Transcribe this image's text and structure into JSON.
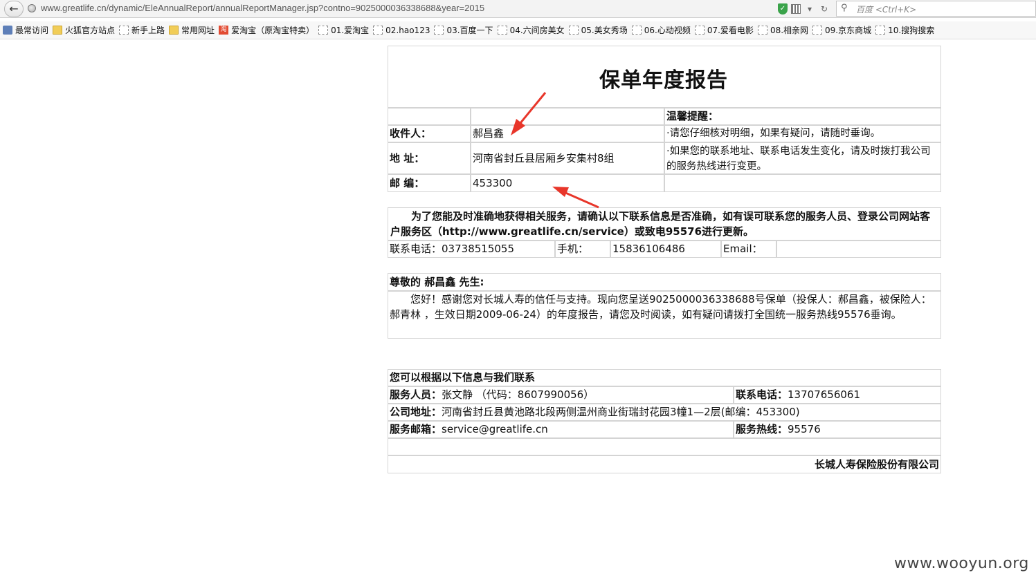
{
  "browser": {
    "url": "www.greatlife.cn/dynamic/EleAnnualReport/annualReportManager.jsp?contno=9025000036338688&year=2015",
    "search_placeholder": "百度 <Ctrl+K>",
    "bookmarks": [
      "最常访问",
      "火狐官方站点",
      "新手上路",
      "常用网址",
      "爱淘宝（原淘宝特卖）",
      "01.爱淘宝",
      "02.hao123",
      "03.百度一下",
      "04.六间房美女",
      "05.美女秀场",
      "06.心动视频",
      "07.爱看电影",
      "08.相亲网",
      "09.京东商城",
      "10.搜狗搜索"
    ]
  },
  "report": {
    "title": "保单年度报告",
    "reminder_label": "温馨提醒：",
    "reminder_1": "·请您仔细核对明细，如果有疑问，请随时垂询。",
    "reminder_2": "·如果您的联系地址、联系电话发生变化，请及时拨打我公司的服务热线进行变更。",
    "recipient_label": "收件人：",
    "recipient": "郝昌鑫",
    "address_label": "地 址：",
    "address": "河南省封丘县居厢乡安集村8组",
    "postcode_label": "邮 编：",
    "postcode": "453300",
    "notice": "为了您能及时准确地获得相关服务，请确认以下联系信息是否准确，如有误可联系您的服务人员、登录公司网站客户服务区（http://www.greatlife.cn/service）或致电95576进行更新。",
    "phone_label": "联系电话：",
    "phone": "03738515055",
    "mobile_label": "手机：",
    "mobile": "15836106486",
    "email_label": "Email：",
    "email": "",
    "greeting": "尊敬的 郝昌鑫 先生:",
    "letter": "您好！感谢您对长城人寿的信任与支持。现向您呈送9025000036338688号保单（投保人：郝昌鑫，被保险人：郝青林 ，生效日期2009-06-24）的年度报告，请您及时阅读，如有疑问请拨打全国统一服务热线95576垂询。",
    "contact_heading": "您可以根据以下信息与我们联系",
    "agent_label": "服务人员：",
    "agent": "张文静 （代码：8607990056）",
    "agent_phone_label": "联系电话：",
    "agent_phone": "13707656061",
    "company_addr_label": "公司地址：",
    "company_addr": "河南省封丘县黄池路北段两侧温州商业街瑞封花园3幢1—2层(邮编：453300)",
    "service_email_label": "服务邮箱：",
    "service_email": "service@greatlife.cn",
    "hotline_label": "服务热线：",
    "hotline": "95576",
    "company": "长城人寿保险股份有限公司"
  },
  "watermark": "www.wooyun.org",
  "colors": {
    "arrow": "#e8362a",
    "border": "#d4d4d4"
  }
}
